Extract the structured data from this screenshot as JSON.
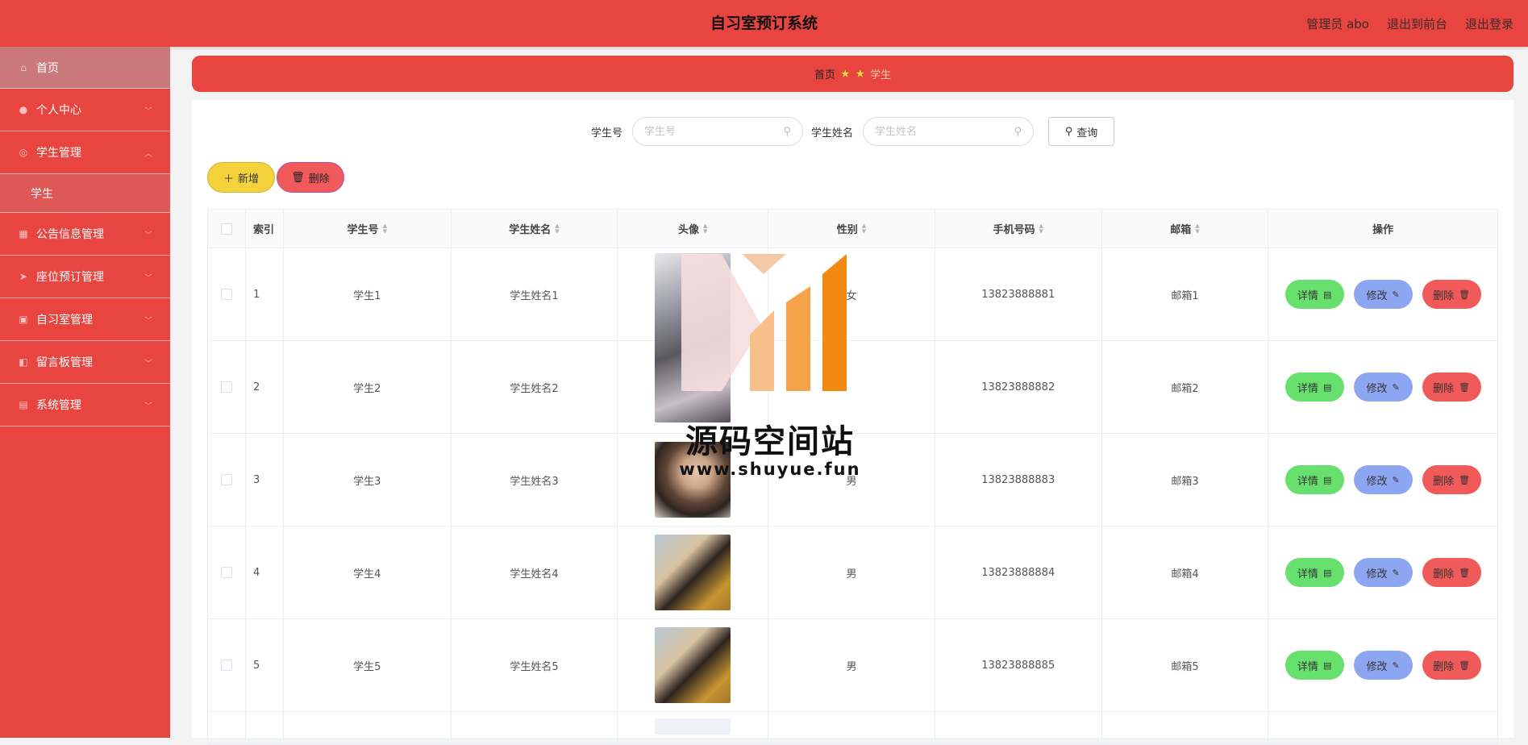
{
  "header": {
    "title": "自习室预订系统",
    "admin_label": "管理员 abo",
    "to_front": "退出到前台",
    "logout": "退出登录"
  },
  "sidebar": {
    "items": [
      {
        "label": "首页",
        "icon": "home-icon"
      },
      {
        "label": "个人中心",
        "icon": "user-icon"
      },
      {
        "label": "学生管理",
        "icon": "compass-icon"
      },
      {
        "label": "学生",
        "icon": ""
      },
      {
        "label": "公告信息管理",
        "icon": "grid-icon"
      },
      {
        "label": "座位预订管理",
        "icon": "send-icon"
      },
      {
        "label": "自习室管理",
        "icon": "image-icon"
      },
      {
        "label": "留言板管理",
        "icon": "video-icon"
      },
      {
        "label": "系统管理",
        "icon": "clipboard-icon"
      }
    ]
  },
  "breadcrumb": {
    "home": "首页",
    "current": "学生"
  },
  "search": {
    "student_no_label": "学生号",
    "student_no_placeholder": "学生号",
    "student_name_label": "学生姓名",
    "student_name_placeholder": "学生姓名",
    "query_label": "查询"
  },
  "toolbar": {
    "add_label": "新增",
    "delete_label": "删除"
  },
  "table": {
    "headers": [
      "索引",
      "学生号",
      "学生姓名",
      "头像",
      "性别",
      "手机号码",
      "邮箱",
      "操作"
    ],
    "rows": [
      {
        "index": "1",
        "no": "学生1",
        "name": "学生姓名1",
        "gender": "女",
        "phone": "13823888881",
        "email": "邮箱1"
      },
      {
        "index": "2",
        "no": "学生2",
        "name": "学生姓名2",
        "gender": "",
        "phone": "13823888882",
        "email": "邮箱2"
      },
      {
        "index": "3",
        "no": "学生3",
        "name": "学生姓名3",
        "gender": "男",
        "phone": "13823888883",
        "email": "邮箱3"
      },
      {
        "index": "4",
        "no": "学生4",
        "name": "学生姓名4",
        "gender": "男",
        "phone": "13823888884",
        "email": "邮箱4"
      },
      {
        "index": "5",
        "no": "学生5",
        "name": "学生姓名5",
        "gender": "男",
        "phone": "13823888885",
        "email": "邮箱5"
      }
    ],
    "ops": {
      "detail": "详情",
      "edit": "修改",
      "remove": "删除"
    }
  },
  "watermark": {
    "line1": "源码空间站",
    "line2": "www.shuyue.fun"
  },
  "colors": {
    "primary": "#e84440",
    "add": "#f3d23b",
    "detail": "#67e06e",
    "edit": "#8da6f2",
    "remove": "#f05a5a"
  }
}
